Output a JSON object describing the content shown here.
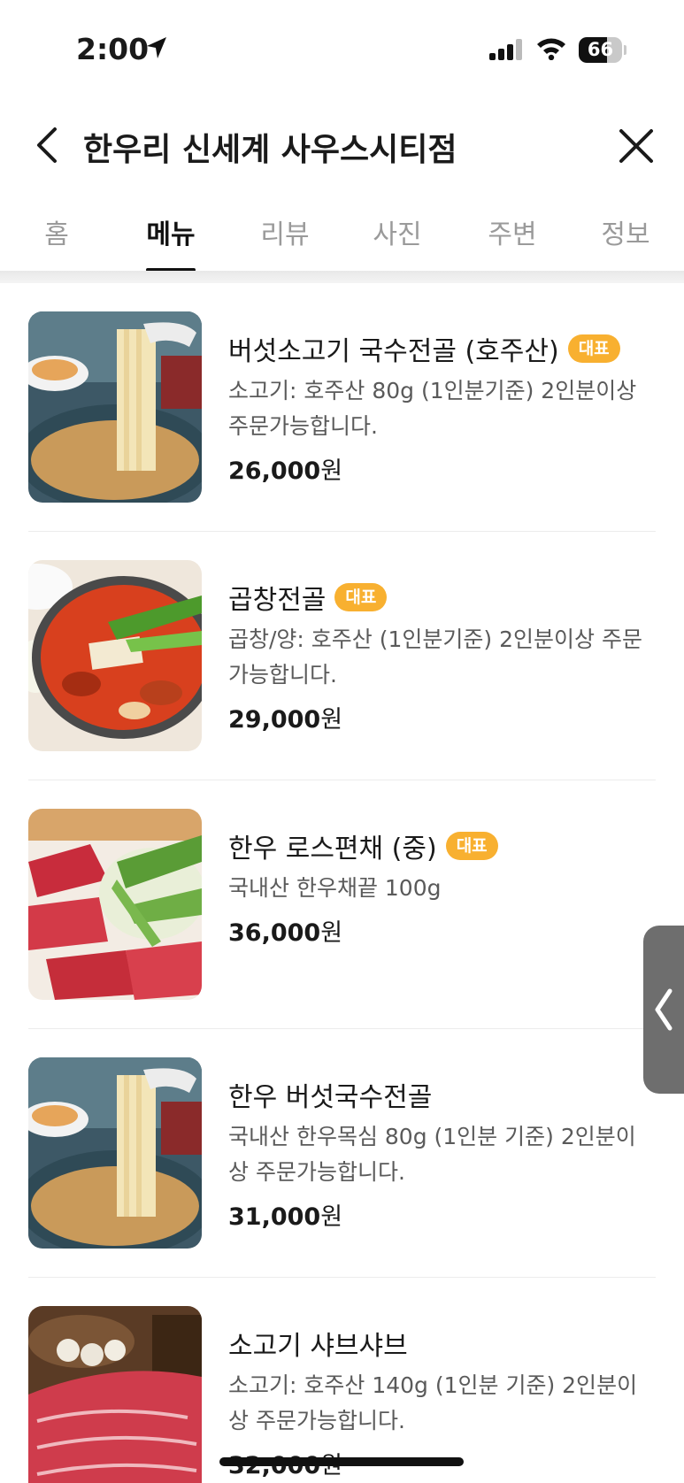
{
  "status_bar": {
    "time": "2:00",
    "battery": "66",
    "battery_level": 0.66,
    "icons": [
      "location-arrow-icon",
      "signal-icon",
      "wifi-icon",
      "battery-icon"
    ]
  },
  "header": {
    "title": "한우리 신세계 사우스시티점",
    "back_icon": "chevron-left-icon",
    "close_icon": "close-icon"
  },
  "tabs": [
    {
      "label": "홈",
      "active": false
    },
    {
      "label": "메뉴",
      "active": true
    },
    {
      "label": "리뷰",
      "active": false
    },
    {
      "label": "사진",
      "active": false
    },
    {
      "label": "주변",
      "active": false
    },
    {
      "label": "정보",
      "active": false
    }
  ],
  "menu_items": [
    {
      "name": "버섯소고기 국수전골 (호주산)",
      "badge": "대표",
      "description": "소고기: 호주산 80g (1인분기준) 2인분이상 주문가능합니다.",
      "price": "26,000",
      "currency": "원",
      "image": "noodle-hotpot-photo"
    },
    {
      "name": "곱창전골",
      "badge": "대표",
      "description": "곱창/양: 호주산 (1인분기준) 2인분이상 주문가능합니다.",
      "price": "29,000",
      "currency": "원",
      "image": "gopchang-hotpot-photo"
    },
    {
      "name": "한우 로스편채 (중)",
      "badge": "대표",
      "description": "국내산 한우채끝 100g",
      "price": "36,000",
      "currency": "원",
      "image": "beef-pyeonchae-photo"
    },
    {
      "name": "한우 버섯국수전골",
      "badge": "",
      "description": "국내산 한우목심 80g (1인분 기준) 2인분이상 주문가능합니다.",
      "price": "31,000",
      "currency": "원",
      "image": "noodle-hotpot-photo"
    },
    {
      "name": "소고기 샤브샤브",
      "badge": "",
      "description": "소고기: 호주산 140g (1인분 기준) 2인분이상 주문가능합니다.",
      "price": "32,000",
      "currency": "원",
      "image": "shabu-beef-photo"
    }
  ],
  "side_handle": {
    "icon": "chevron-left-icon"
  },
  "colors": {
    "badge": "#f8b030",
    "text_primary": "#1a1a1a",
    "text_secondary": "#5a5a5a",
    "tab_inactive": "#9a9a9a"
  }
}
